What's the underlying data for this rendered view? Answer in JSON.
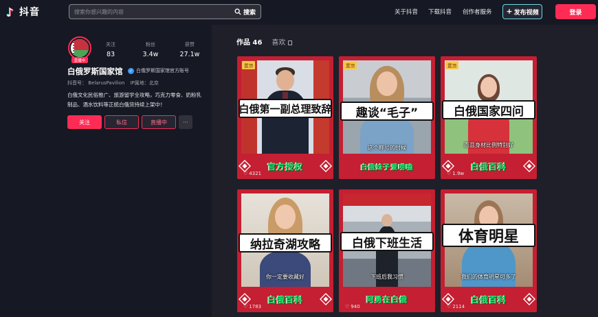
{
  "header": {
    "brand": "抖音",
    "search_placeholder": "搜索你感兴趣的内容",
    "search_button": "搜索",
    "nav": [
      "关于抖音",
      "下载抖音",
      "创作者服务"
    ],
    "publish_label": "发布视频",
    "login_label": "登录"
  },
  "profile": {
    "live_badge": "直播中",
    "stats": [
      {
        "label": "关注",
        "value": "83"
      },
      {
        "label": "粉丝",
        "value": "3.4w"
      },
      {
        "label": "获赞",
        "value": "27.1w"
      }
    ],
    "name": "白俄罗斯国家馆",
    "verified_text": "白俄罗斯国家馆官方账号",
    "douyin_id": "抖音号： BelarusPavilion",
    "ip_location": "IP属地：北京",
    "bio": "白俄文化民俗推广、旅游留学全攻略，巧克力零食、奶粉乳制品、酒水饮料等正统白俄货持续上架中！",
    "buttons": {
      "follow": "关注",
      "message": "私信",
      "live": "直播中",
      "more": "···"
    }
  },
  "tabs": {
    "works": "作品 46",
    "likes": "喜欢"
  },
  "colors": {
    "accent": "#fe2c55",
    "card_red": "#c41f32",
    "banner_green": "#27e06b",
    "background": "#161823"
  },
  "videos": [
    {
      "pinned": "置顶",
      "title": "白俄第一副总理致辞",
      "subtitle": "",
      "banner": "官方授权",
      "likes": "4321"
    },
    {
      "pinned": "置顶",
      "title": "趣谈“毛子”",
      "subtitle": "这个称号的时候",
      "banner": "白俄妹子爱唠嗑",
      "likes": ""
    },
    {
      "pinned": "置顶",
      "title": "白俄国家四问",
      "subtitle": "而且身材比例特别好",
      "banner": "白俄百科",
      "likes": "1.9w"
    },
    {
      "pinned": "",
      "title": "纳拉奇湖攻略",
      "subtitle": "你一定要收藏好",
      "banner": "白俄百科",
      "likes": "1783"
    },
    {
      "pinned": "",
      "title": "白俄下班生活",
      "subtitle": "下班后我习惯",
      "banner": "阿勇在白俄",
      "likes": "940"
    },
    {
      "pinned": "",
      "title": "体育明星",
      "subtitle": "我们的体育明星可多了",
      "banner": "白俄百科",
      "likes": "2114"
    }
  ]
}
